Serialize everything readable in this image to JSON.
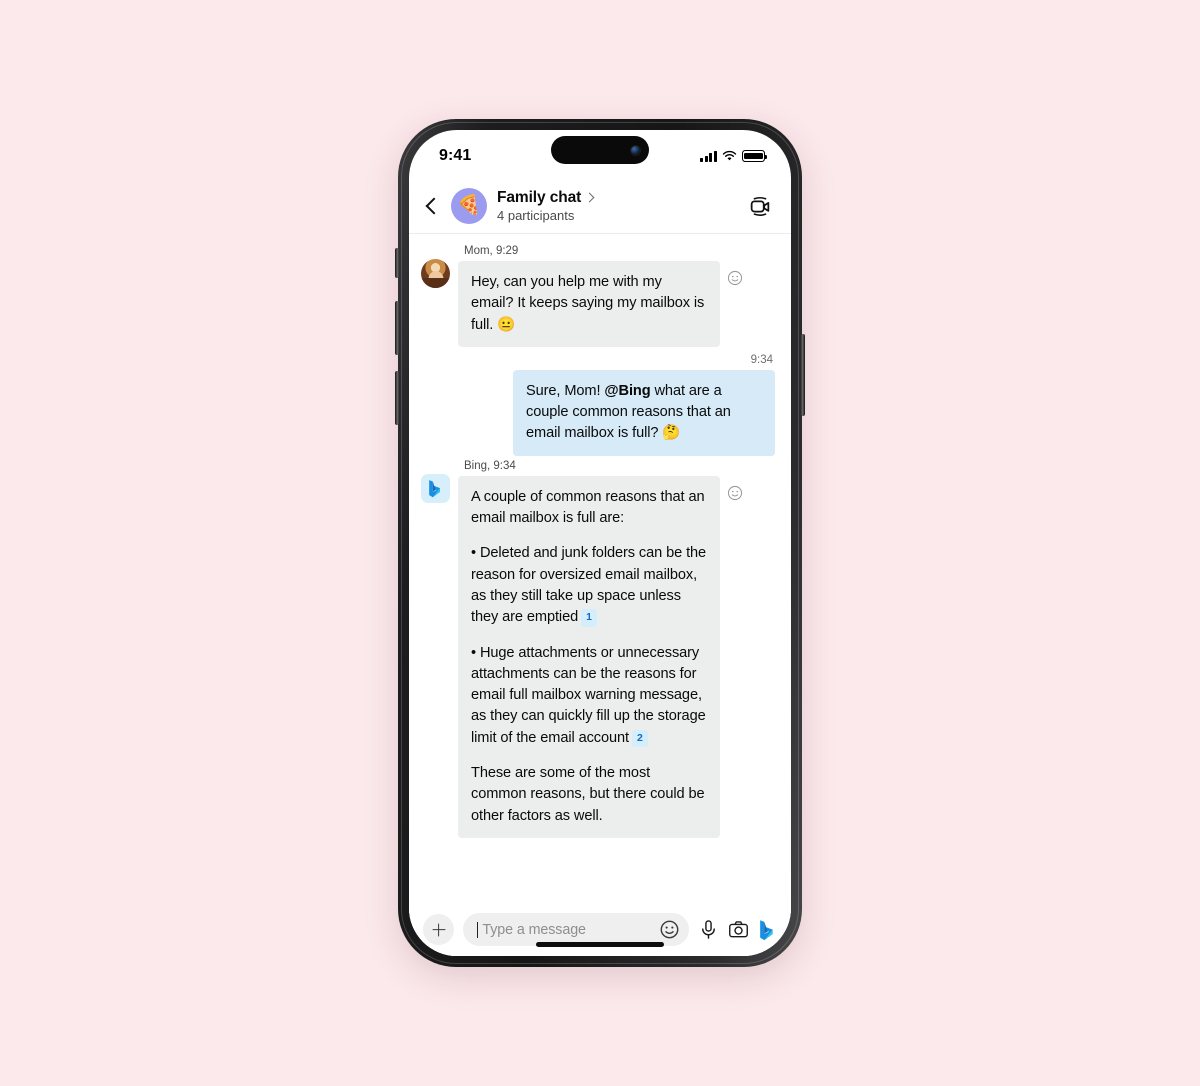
{
  "statusbar": {
    "time": "9:41",
    "signal_icon": "cellular-bars-icon",
    "wifi_icon": "wifi-icon",
    "battery_icon": "battery-full-icon"
  },
  "header": {
    "back_icon": "back-chevron-icon",
    "avatar_emoji": "🍕",
    "title": "Family chat",
    "disclosure_icon": "chevron-right-icon",
    "subtitle": "4 participants",
    "video_call_icon": "video-camera-icon"
  },
  "messages": [
    {
      "id": "mom-msg",
      "direction": "incoming",
      "sender": "Mom, 9:29",
      "avatar": "mom-photo-avatar",
      "text": "Hey, can you help me with my email? It keeps saying my mailbox is full. 😐",
      "reaction_icon": "add-reaction-smiley-icon"
    },
    {
      "id": "user-msg",
      "direction": "outgoing",
      "timestamp": "9:34",
      "text_before_mention": "Sure, Mom! ",
      "mention": "@Bing",
      "text_after_mention": " what are a couple common reasons that an email mailbox is full? 🤔"
    },
    {
      "id": "bing-msg",
      "direction": "incoming",
      "sender": "Bing, 9:34",
      "avatar": "bing-logo-avatar",
      "reaction_icon": "add-reaction-smiley-icon",
      "paragraphs": [
        "A couple of common reasons that an email mailbox is full are:",
        "• Deleted and junk folders can be the reason for oversized email mailbox, as they still take up space unless they are emptied",
        "• Huge attachments or unnecessary attachments can be the reasons for email full mailbox warning message, as they can quickly fill up the storage limit of the email account",
        "These are some of the most common reasons, but there could be other factors as well."
      ],
      "citations": [
        "1",
        "2"
      ]
    }
  ],
  "composer": {
    "add_icon": "plus-icon",
    "placeholder": "Type a message",
    "emoji_icon": "emoji-smiley-icon",
    "mic_icon": "microphone-icon",
    "camera_icon": "camera-icon",
    "bing_icon": "bing-logo-icon"
  },
  "colors": {
    "page_background": "#fce9ec",
    "incoming_bubble": "#eceded",
    "outgoing_bubble": "#d6eaf7",
    "citation_badge_bg": "#d5eefb",
    "citation_badge_text": "#1868c4",
    "avatar_ring": "#9b9bf0"
  }
}
